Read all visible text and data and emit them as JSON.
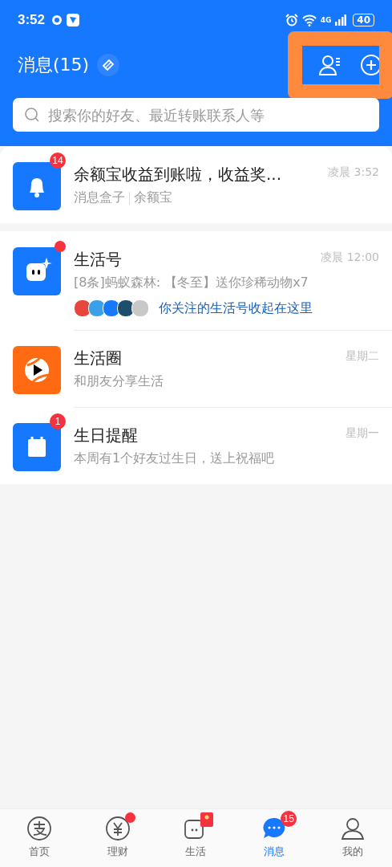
{
  "status_bar": {
    "time": "3:52",
    "network": "4G",
    "battery": "40"
  },
  "header": {
    "title": "消息(15)",
    "actions_highlighted": true
  },
  "search": {
    "placeholder": "搜索你的好友、最近转账联系人等"
  },
  "pinned": {
    "kind": "bell",
    "badge": "14",
    "title": "余额宝收益到账啦，收益奖...",
    "sources": [
      "消息盒子",
      "余额宝"
    ],
    "time": "凌晨 3:52"
  },
  "items": [
    {
      "kind": "bot",
      "dot": true,
      "title": "生活号",
      "preview": "[8条]蚂蚁森林: 【冬至】送你珍稀动物x7",
      "time": "凌晨 12:00",
      "followed": {
        "text": "你关注的生活号收起在这里",
        "avatars": [
          {
            "color": "#e8453c"
          },
          {
            "color": "#3aa0e8"
          },
          {
            "color": "#1677ff"
          },
          {
            "color": "#1d4e6b"
          },
          {
            "color": "#c8c8c8"
          }
        ]
      }
    },
    {
      "kind": "play",
      "dot": false,
      "title": "生活圈",
      "preview": "和朋友分享生活",
      "time": "星期二"
    },
    {
      "kind": "calendar",
      "badge": "1",
      "title": "生日提醒",
      "preview": "本周有1个好友过生日，送上祝福吧",
      "time": "星期一"
    }
  ],
  "tabs": [
    {
      "kind": "alipay",
      "label": "首页",
      "selected": false,
      "dot": false
    },
    {
      "kind": "yuan",
      "label": "理财",
      "selected": false,
      "dot": true
    },
    {
      "kind": "life",
      "label": "生活",
      "selected": false,
      "packet": true
    },
    {
      "kind": "chat",
      "label": "消息",
      "selected": true,
      "badge": "15"
    },
    {
      "kind": "user",
      "label": "我的",
      "selected": false,
      "dot": false
    }
  ]
}
